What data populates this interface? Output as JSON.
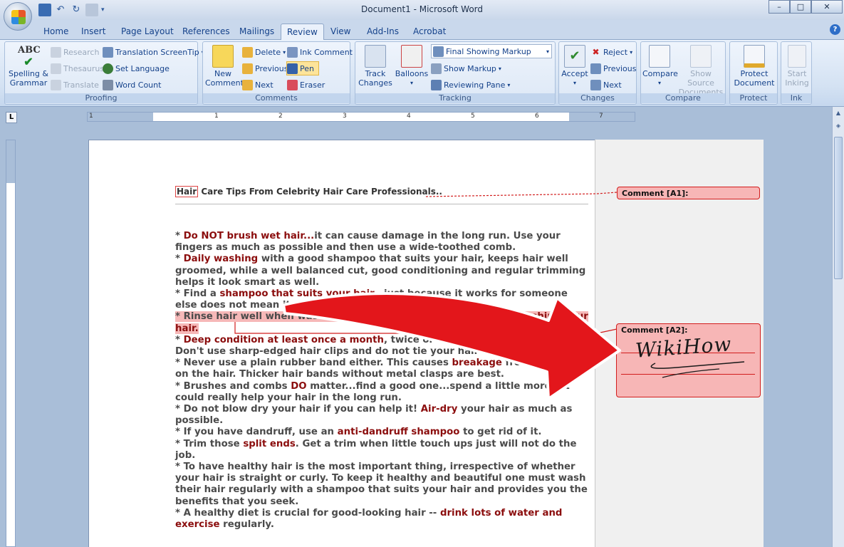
{
  "window": {
    "title": "Document1 - Microsoft Word",
    "controls": {
      "minimize": "–",
      "maximize": "□",
      "close": "✕"
    }
  },
  "help_label": "?",
  "tabs": [
    {
      "label": "Home"
    },
    {
      "label": "Insert"
    },
    {
      "label": "Page Layout"
    },
    {
      "label": "References"
    },
    {
      "label": "Mailings"
    },
    {
      "label": "Review",
      "active": true
    },
    {
      "label": "View"
    },
    {
      "label": "Add-Ins"
    },
    {
      "label": "Acrobat"
    }
  ],
  "ribbon": {
    "proofing": {
      "label": "Proofing",
      "spelling_label_1": "Spelling &",
      "spelling_label_2": "Grammar",
      "abc_text": "ABC",
      "research": "Research",
      "thesaurus": "Thesaurus",
      "translate": "Translate",
      "translation_screentip": "Translation ScreenTip",
      "set_language": "Set Language",
      "word_count": "Word Count"
    },
    "comments": {
      "label": "Comments",
      "new_comment_1": "New",
      "new_comment_2": "Comment",
      "delete": "Delete",
      "previous": "Previous",
      "next": "Next",
      "ink_comment": "Ink Comment",
      "pen": "Pen",
      "eraser": "Eraser"
    },
    "tracking": {
      "label": "Tracking",
      "track_changes_1": "Track",
      "track_changes_2": "Changes",
      "balloons": "Balloons",
      "markup_select": "Final Showing Markup",
      "show_markup": "Show Markup",
      "reviewing_pane": "Reviewing Pane"
    },
    "changes": {
      "label": "Changes",
      "accept": "Accept",
      "reject": "Reject",
      "previous": "Previous",
      "next": "Next"
    },
    "compare": {
      "label": "Compare",
      "compare": "Compare",
      "show_source_1": "Show Source",
      "show_source_2": "Documents"
    },
    "protect": {
      "label": "Protect",
      "protect_1": "Protect",
      "protect_2": "Document"
    },
    "ink": {
      "label": "Ink",
      "start_1": "Start",
      "start_2": "Inking"
    }
  },
  "ruler_numbers": [
    "1",
    "1",
    "2",
    "3",
    "4",
    "5",
    "6",
    "7"
  ],
  "tab_selector": "L",
  "document": {
    "title_first_word": "Hair",
    "title_rest": " Care Tips From Celebrity Hair Care Professionals..",
    "paragraphs": [
      {
        "a": "* ",
        "b": "Do NOT brush wet hair...",
        "c": "it can cause damage in the long run. Use your fingers as much as possible and then use a wide-toothed comb."
      },
      {
        "a": "* ",
        "b": "Daily washing",
        "c": " with a good shampoo that suits your hair, keeps hair well groomed, while a well balanced cut, good conditioning  and regular trimming helps it look smart as well."
      },
      {
        "a": "* Find a ",
        "b": "shampoo that suits your hair",
        "c": "...just because it works for someone else does not mean it will work for you!"
      },
      {
        "a": "* Rinse hair well when washing, but ",
        "b": "do not use hot water while washing your hair.",
        "c": ""
      },
      {
        "a": "* ",
        "b": "Deep condition at least once a month",
        "c": ", twice or more for dry, damaged hair. Don't use sharp-edged hair clips and do not tie your hair tightly."
      },
      {
        "a": "* Never use a plain rubber band either. This causes ",
        "b": "breakage",
        "c": " from pressure on the hair. Thicker hair bands without metal clasps are best."
      },
      {
        "a": "* Brushes and combs ",
        "b": "DO",
        "c": " matter...find a good one...spend a little more...it could really help your hair in the long run."
      },
      {
        "a": "* Do not blow dry your hair if you can help it! ",
        "b": "Air-dry",
        "c": " your hair as much as possible."
      },
      {
        "a": "* If you have dandruff, use an ",
        "b": "anti-dandruff shampoo",
        "c": " to get rid of it."
      },
      {
        "a": "* Trim those ",
        "b": "split ends",
        "c": ". Get a trim when little  touch ups just will not do the job."
      },
      {
        "a": "* To have healthy hair is the most important thing, irrespective of whether your hair is straight or curly. To keep it healthy and beautiful one must wash their hair regularly with a shampoo that suits your hair and provides you the benefits that you seek.",
        "b": "",
        "c": ""
      },
      {
        "a": "* A healthy diet is crucial for good-looking  hair -- ",
        "b": "drink lots of water and exercise",
        "c": " regularly."
      }
    ],
    "comments": [
      {
        "label": "Comment [A1]:"
      },
      {
        "label": "Comment [A2]:",
        "ink_text": "WikiHow"
      }
    ]
  },
  "colors": {
    "accent_red": "#e3161b",
    "highlight_text": "#8b0d0d",
    "comment_fill": "#f7b6b6"
  }
}
